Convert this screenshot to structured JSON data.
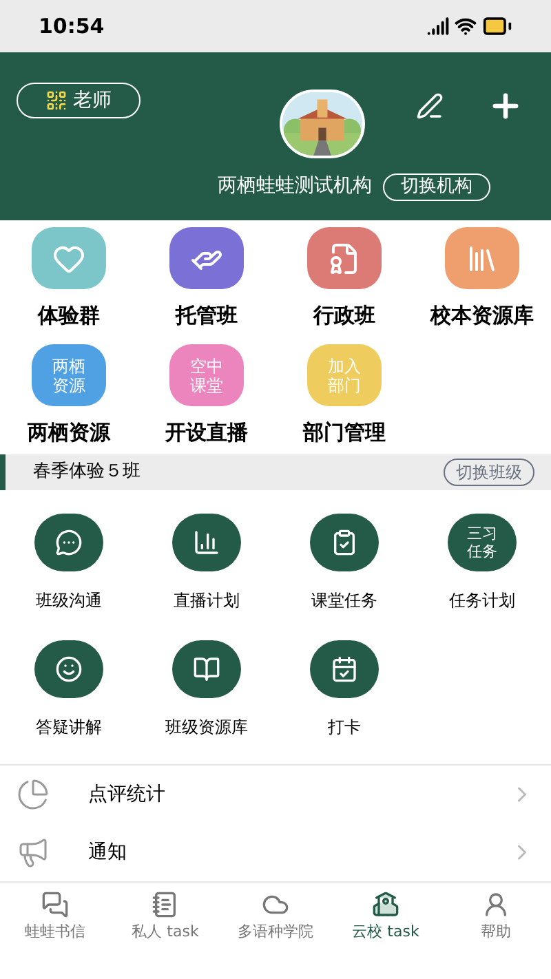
{
  "status_bar": {
    "time": "10:54"
  },
  "header": {
    "role_button": "老师",
    "org_name": "两栖蛙蛙测试机构",
    "switch_org": "切换机构"
  },
  "features": [
    {
      "kind": "icon",
      "label": "体验群",
      "color": "#7cc5c9"
    },
    {
      "kind": "icon",
      "label": "托管班",
      "color": "#7b70d6"
    },
    {
      "kind": "icon",
      "label": "行政班",
      "color": "#dc7b76"
    },
    {
      "kind": "icon",
      "label": "校本资源库",
      "color": "#ef9f6e"
    },
    {
      "kind": "text",
      "tile_text": "两栖资源",
      "label": "两栖资源",
      "color": "#4fa1e3"
    },
    {
      "kind": "text",
      "tile_text": "空中课堂",
      "label": "开设直播",
      "color": "#ec84be"
    },
    {
      "kind": "text",
      "tile_text": "加入部门",
      "label": "部门管理",
      "color": "#efcc5e"
    }
  ],
  "class_bar": {
    "name": "春季体验５班",
    "switch": "切换班级"
  },
  "class_tools": [
    {
      "kind": "icon",
      "label": "班级沟通"
    },
    {
      "kind": "icon",
      "label": "直播计划"
    },
    {
      "kind": "icon",
      "label": "课堂任务"
    },
    {
      "kind": "text",
      "tile_text": "三习任务",
      "label": "任务计划"
    },
    {
      "kind": "icon",
      "label": "答疑讲解"
    },
    {
      "kind": "icon",
      "label": "班级资源库"
    },
    {
      "kind": "icon",
      "label": "打卡"
    }
  ],
  "list": [
    {
      "label": "点评统计"
    },
    {
      "label": "通知"
    }
  ],
  "tabs": [
    {
      "label": "蛙蛙书信",
      "selected": false
    },
    {
      "label": "私人 task",
      "selected": false
    },
    {
      "label": "多语种学院",
      "selected": false
    },
    {
      "label": "云校 task",
      "selected": true
    },
    {
      "label": "帮助",
      "selected": false
    }
  ]
}
